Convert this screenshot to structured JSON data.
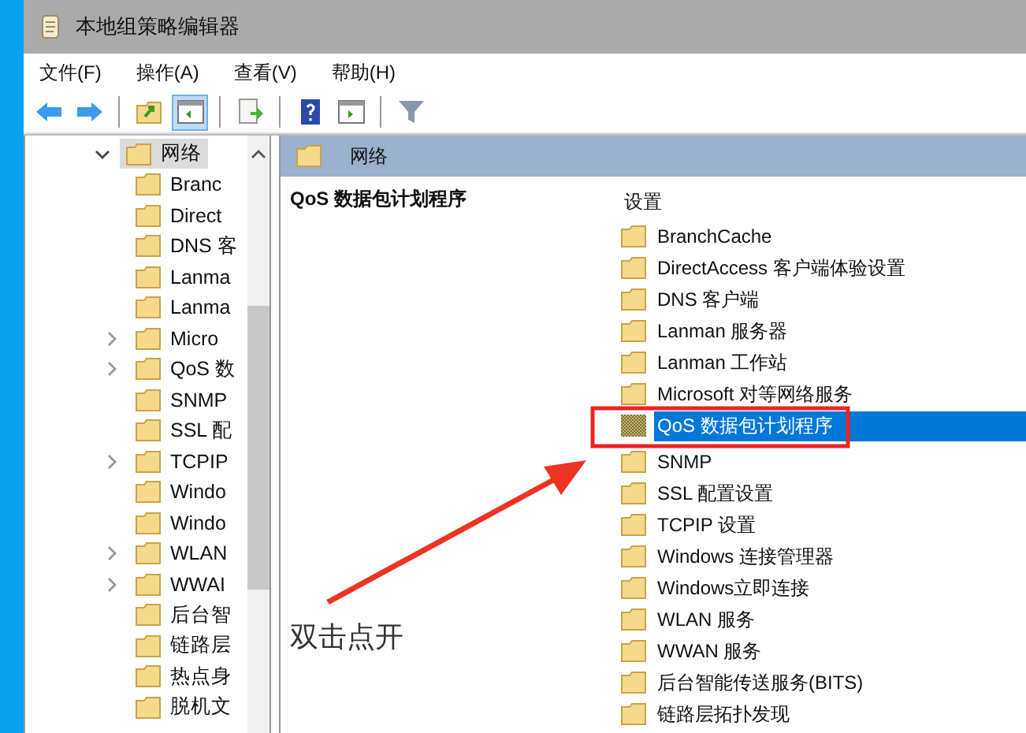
{
  "window": {
    "title": "本地组策略编辑器"
  },
  "menu": [
    "文件(F)",
    "操作(A)",
    "查看(V)",
    "帮助(H)"
  ],
  "toolbar": [
    {
      "kind": "back",
      "pressed": false
    },
    {
      "kind": "forward",
      "pressed": false
    },
    {
      "kind": "up",
      "pressed": false,
      "group_start": true
    },
    {
      "kind": "pane",
      "pressed": true
    },
    {
      "kind": "export",
      "pressed": false,
      "group_start": true
    },
    {
      "kind": "help",
      "pressed": false,
      "group_start": true
    },
    {
      "kind": "pane2",
      "pressed": false
    },
    {
      "kind": "filter",
      "pressed": false,
      "group_start": true
    }
  ],
  "tree": {
    "label": "网络",
    "expanded": true,
    "selected": true,
    "children": [
      {
        "label": "Branc",
        "expandable": false
      },
      {
        "label": "Direct",
        "expandable": false
      },
      {
        "label": "DNS 客",
        "expandable": false
      },
      {
        "label": "Lanma",
        "expandable": false
      },
      {
        "label": "Lanma",
        "expandable": false
      },
      {
        "label": "Micro",
        "expandable": true
      },
      {
        "label": "QoS 数",
        "expandable": true
      },
      {
        "label": "SNMP",
        "expandable": false
      },
      {
        "label": "SSL 配",
        "expandable": false
      },
      {
        "label": "TCPIP",
        "expandable": true
      },
      {
        "label": "Windo",
        "expandable": false
      },
      {
        "label": "Windo",
        "expandable": false
      },
      {
        "label": "WLAN",
        "expandable": true
      },
      {
        "label": "WWAI",
        "expandable": true
      },
      {
        "label": "后台智",
        "expandable": false
      },
      {
        "label": "链路层",
        "expandable": false
      },
      {
        "label": "热点身",
        "expandable": false
      },
      {
        "label": "脱机文",
        "expandable": false
      }
    ]
  },
  "header": {
    "title": "网络"
  },
  "description": {
    "title": "QoS 数据包计划程序"
  },
  "list": {
    "heading": "设置",
    "items": [
      {
        "label": "BranchCache",
        "selected": false
      },
      {
        "label": "DirectAccess 客户端体验设置",
        "selected": false
      },
      {
        "label": "DNS 客户端",
        "selected": false
      },
      {
        "label": "Lanman 服务器",
        "selected": false
      },
      {
        "label": "Lanman 工作站",
        "selected": false
      },
      {
        "label": "Microsoft 对等网络服务",
        "selected": false
      },
      {
        "label": "QoS 数据包计划程序",
        "selected": true
      },
      {
        "label": "SNMP",
        "selected": false
      },
      {
        "label": "SSL 配置设置",
        "selected": false
      },
      {
        "label": "TCPIP 设置",
        "selected": false
      },
      {
        "label": "Windows 连接管理器",
        "selected": false
      },
      {
        "label": "Windows立即连接",
        "selected": false
      },
      {
        "label": "WLAN 服务",
        "selected": false
      },
      {
        "label": "WWAN 服务",
        "selected": false
      },
      {
        "label": "后台智能传送服务(BITS)",
        "selected": false
      },
      {
        "label": "链路层拓扑发现",
        "selected": false
      }
    ]
  },
  "annotation": {
    "text": "双击点开"
  }
}
